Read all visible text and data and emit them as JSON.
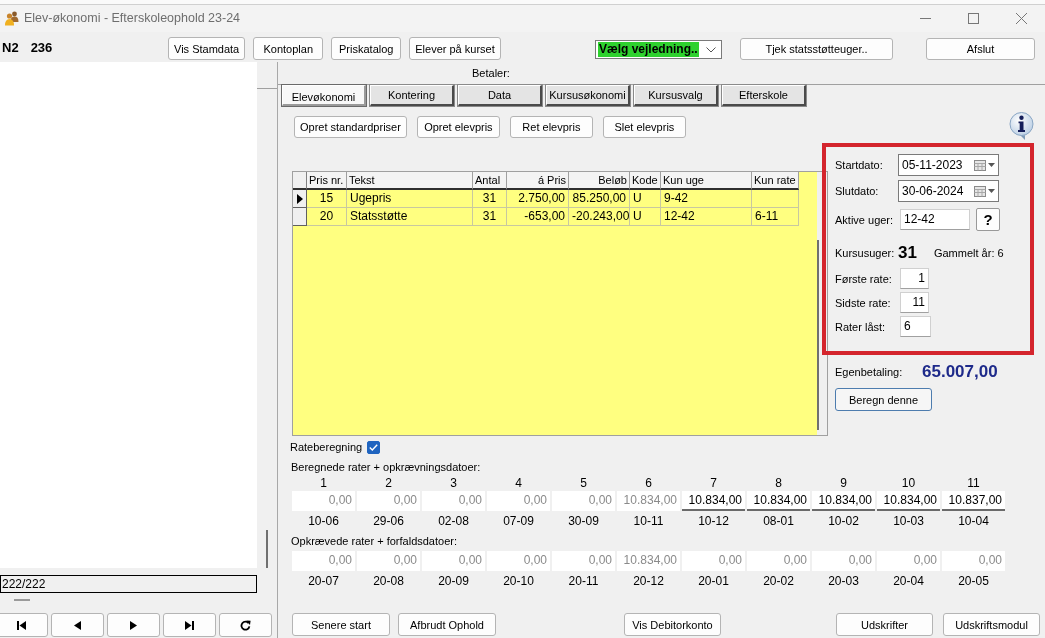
{
  "window": {
    "title": "Elev-økonomi - Efterskoleophold 23-24"
  },
  "student": {
    "code": "N2",
    "number": "236"
  },
  "toolbar": {
    "buttons": [
      "Vis Stamdata",
      "Kontoplan",
      "Priskatalog",
      "Elever på kurset"
    ],
    "guide_dropdown": {
      "value": "Vælg vejledning.."
    },
    "check_button": "Tjek statsstøtteuger..",
    "close_button": "Afslut"
  },
  "left_panel": {
    "record_counter": "222/222",
    "navigator": [
      {
        "kind": "first"
      },
      {
        "kind": "previous"
      },
      {
        "kind": "next"
      },
      {
        "kind": "last"
      },
      {
        "kind": "refresh"
      }
    ]
  },
  "payer_label": "Betaler:",
  "tabs": [
    {
      "label": "Elevøkonomi",
      "selected": true
    },
    {
      "label": "Kontering",
      "selected": false
    },
    {
      "label": "Data",
      "selected": false
    },
    {
      "label": "Kursusøkonomi",
      "selected": false
    },
    {
      "label": "Kursusvalg",
      "selected": false
    },
    {
      "label": "Efterskole",
      "selected": false
    }
  ],
  "price_actions": [
    "Opret standardpriser",
    "Opret elevpris",
    "Ret elevpris",
    "Slet elevpris"
  ],
  "price_table": {
    "columns": [
      "Pris nr.",
      "Tekst",
      "Antal",
      "á Pris",
      "Beløb",
      "Kode",
      "Kun uge",
      "Kun rate"
    ],
    "rows": [
      {
        "selected": true,
        "cells": [
          "15",
          "Ugepris",
          "31",
          "2.750,00",
          "85.250,00",
          "U",
          "9-42"
        ]
      },
      {
        "selected": false,
        "cells": [
          "20",
          "Statsstøtte",
          "31",
          "-653,00",
          "-20.243,00",
          "U",
          "12-42",
          "6-11"
        ]
      }
    ]
  },
  "period_panel": {
    "highlighted": true,
    "rows": [
      {
        "kind": "date",
        "label": "Startdato:",
        "value": "05-11-2023"
      },
      {
        "kind": "date",
        "label": "Slutdato:",
        "value": "30-06-2024"
      },
      {
        "kind": "weeks",
        "label": "Aktive uger:",
        "value": "12-42",
        "help": "?"
      },
      {
        "kind": "count",
        "label": "Kursusuger:",
        "value": "31",
        "note": "Gammelt år: 6"
      },
      {
        "kind": "number",
        "label": "Første rate:",
        "value": "1"
      },
      {
        "kind": "number",
        "label": "Sidste rate:",
        "value": "11"
      },
      {
        "kind": "text",
        "label": "Rater låst:",
        "value": "6"
      }
    ]
  },
  "own_payment": {
    "label": "Egenbetaling:",
    "value": "65.007,00"
  },
  "calculate_button": "Beregn denne",
  "rate_calculation": {
    "label": "Rateberegning",
    "checked": true
  },
  "calculated_rates": {
    "title": "Beregnede rater + opkrævningsdatoer:",
    "items": [
      {
        "number": "1",
        "amount": "0,00",
        "date": "10-06",
        "disabled": true
      },
      {
        "number": "2",
        "amount": "0,00",
        "date": "29-06",
        "disabled": true
      },
      {
        "number": "3",
        "amount": "0,00",
        "date": "02-08",
        "disabled": true
      },
      {
        "number": "4",
        "amount": "0,00",
        "date": "07-09",
        "disabled": true
      },
      {
        "number": "5",
        "amount": "0,00",
        "date": "30-09",
        "disabled": true
      },
      {
        "number": "6",
        "amount": "10.834,00",
        "date": "10-11",
        "disabled": true
      },
      {
        "number": "7",
        "amount": "10.834,00",
        "date": "10-12",
        "disabled": false
      },
      {
        "number": "8",
        "amount": "10.834,00",
        "date": "08-01",
        "disabled": false
      },
      {
        "number": "9",
        "amount": "10.834,00",
        "date": "10-02",
        "disabled": false
      },
      {
        "number": "10",
        "amount": "10.834,00",
        "date": "10-03",
        "disabled": false
      },
      {
        "number": "11",
        "amount": "10.837,00",
        "date": "10-04",
        "disabled": false
      }
    ]
  },
  "collected_rates": {
    "title": "Opkrævede rater + forfaldsdatoer:",
    "items": [
      {
        "amount": "0,00",
        "date": "20-07",
        "disabled": true
      },
      {
        "amount": "0,00",
        "date": "20-08",
        "disabled": true
      },
      {
        "amount": "0,00",
        "date": "20-09",
        "disabled": true
      },
      {
        "amount": "0,00",
        "date": "20-10",
        "disabled": true
      },
      {
        "amount": "0,00",
        "date": "20-11",
        "disabled": true
      },
      {
        "amount": "10.834,00",
        "date": "20-12",
        "disabled": true
      },
      {
        "amount": "0,00",
        "date": "20-01",
        "disabled": true
      },
      {
        "amount": "0,00",
        "date": "20-02",
        "disabled": true
      },
      {
        "amount": "0,00",
        "date": "20-03",
        "disabled": true
      },
      {
        "amount": "0,00",
        "date": "20-04",
        "disabled": true
      },
      {
        "amount": "0,00",
        "date": "20-05",
        "disabled": true
      }
    ]
  },
  "bottom_buttons": {
    "left": [
      "Senere start",
      "Afbrudt Ophold"
    ],
    "center": [
      "Vis Debitorkonto"
    ],
    "right": [
      "Udskrifter",
      "Udskriftsmodul"
    ]
  }
}
